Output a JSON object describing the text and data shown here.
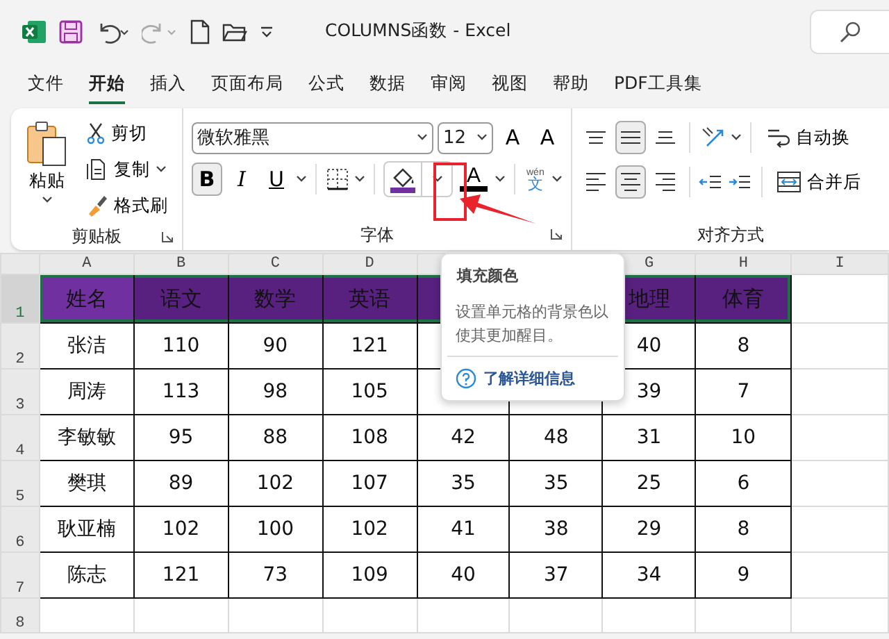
{
  "window": {
    "title": "COLUMNS函数  -  Excel"
  },
  "ribbon_tabs": [
    {
      "label": "文件",
      "selected": false
    },
    {
      "label": "开始",
      "selected": true
    },
    {
      "label": "插入",
      "selected": false
    },
    {
      "label": "页面布局",
      "selected": false
    },
    {
      "label": "公式",
      "selected": false
    },
    {
      "label": "数据",
      "selected": false
    },
    {
      "label": "审阅",
      "selected": false
    },
    {
      "label": "视图",
      "selected": false
    },
    {
      "label": "帮助",
      "selected": false
    },
    {
      "label": "PDF工具集",
      "selected": false
    }
  ],
  "clipboard": {
    "paste": "粘贴",
    "cut": "剪切",
    "copy": "复制",
    "format_painter": "格式刷",
    "label": "剪贴板"
  },
  "font": {
    "font_name": "微软雅黑",
    "font_size": "12",
    "grow_font": "A",
    "shrink_font": "A",
    "styles": [
      {
        "label": "B",
        "kind": "bold",
        "pressed": true
      },
      {
        "label": "I",
        "kind": "italic",
        "pressed": false
      },
      {
        "label": "U",
        "kind": "underline",
        "pressed": false
      }
    ],
    "font_color_label": "A",
    "phonetic_top": "wén",
    "phonetic_bottom": "文",
    "label": "字体"
  },
  "alignment": {
    "vertical": [
      {
        "kind": "top",
        "pressed": false
      },
      {
        "kind": "middle",
        "pressed": true
      },
      {
        "kind": "bottom",
        "pressed": false
      }
    ],
    "horizontal": [
      {
        "kind": "left",
        "pressed": false
      },
      {
        "kind": "center",
        "pressed": true
      },
      {
        "kind": "right",
        "pressed": false
      }
    ],
    "wrap_text": "自动换",
    "merge": "合并后",
    "label": "对齐方式"
  },
  "sheet": {
    "columns": [
      "A",
      "B",
      "C",
      "D",
      null,
      null,
      "G",
      "H",
      "I"
    ],
    "rows": [
      {
        "number": "1",
        "kind": "header",
        "selected": true,
        "cells": [
          "姓名",
          "语文",
          "数学",
          "英语",
          null,
          null,
          "地理",
          "体育"
        ]
      },
      {
        "number": "2",
        "kind": "data",
        "selected": false,
        "cells": [
          "张洁",
          "110",
          "90",
          "121",
          null,
          null,
          "40",
          "8"
        ]
      },
      {
        "number": "3",
        "kind": "data",
        "selected": false,
        "cells": [
          "周涛",
          "113",
          "98",
          "105",
          null,
          null,
          "39",
          "7"
        ]
      },
      {
        "number": "4",
        "kind": "data",
        "selected": false,
        "cells": [
          "李敏敏",
          "95",
          "88",
          "108",
          "42",
          "48",
          "31",
          "10"
        ]
      },
      {
        "number": "5",
        "kind": "data",
        "selected": false,
        "cells": [
          "樊琪",
          "89",
          "102",
          "107",
          "35",
          "35",
          "25",
          "6"
        ]
      },
      {
        "number": "6",
        "kind": "data",
        "selected": false,
        "cells": [
          "耿亚楠",
          "102",
          "100",
          "102",
          "41",
          "38",
          "29",
          "8"
        ]
      },
      {
        "number": "7",
        "kind": "data",
        "selected": false,
        "cells": [
          "陈志",
          "121",
          "73",
          "109",
          "40",
          "37",
          "34",
          "9"
        ]
      },
      {
        "number": "8",
        "kind": "empty",
        "selected": false,
        "cells": []
      }
    ]
  },
  "tooltip": {
    "title": "填充颜色",
    "body": "设置单元格的背景色以使其更加醒目。",
    "link": "了解详细信息"
  }
}
